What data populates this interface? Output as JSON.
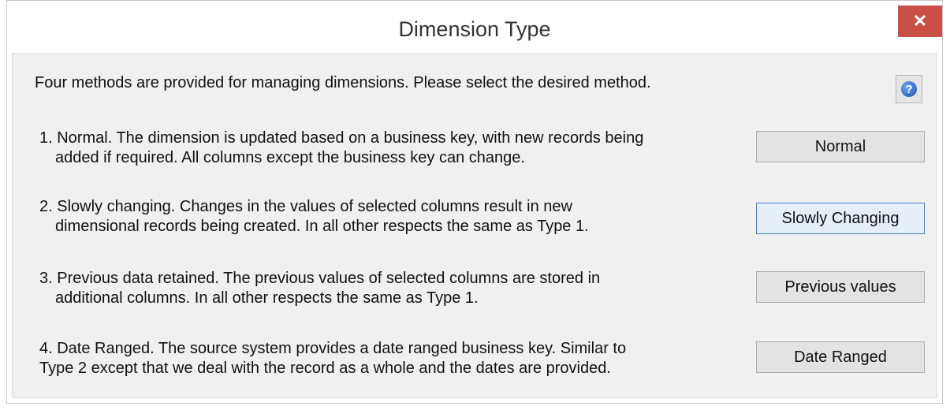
{
  "window": {
    "title": "Dimension Type",
    "close_label": "✕"
  },
  "intro": "Four methods are provided for managing dimensions. Please select the desired method.",
  "help_glyph": "?",
  "options": [
    {
      "line1": "1. Normal. The dimension is updated based on a business key, with new records being",
      "line2": "added if required. All columns except the business key can change.",
      "button": "Normal"
    },
    {
      "line1": "2. Slowly changing. Changes in the values of selected columns result in new",
      "line2": "dimensional records being created. In all other respects the same as Type 1.",
      "button": "Slowly Changing"
    },
    {
      "line1": "3. Previous data retained. The previous values of selected columns are stored in",
      "line2": "additional columns. In all other respects the same as Type 1.",
      "button": "Previous values"
    },
    {
      "line1": "4. Date Ranged. The source system provides a date ranged business key. Similar to",
      "line2": "Type 2 except that we deal with the record as a whole and the dates are provided.",
      "button": "Date Ranged"
    }
  ],
  "colors": {
    "close_button": "#c94f47",
    "client_background": "#f0f0f0",
    "focus_border": "#3c7fd8"
  }
}
